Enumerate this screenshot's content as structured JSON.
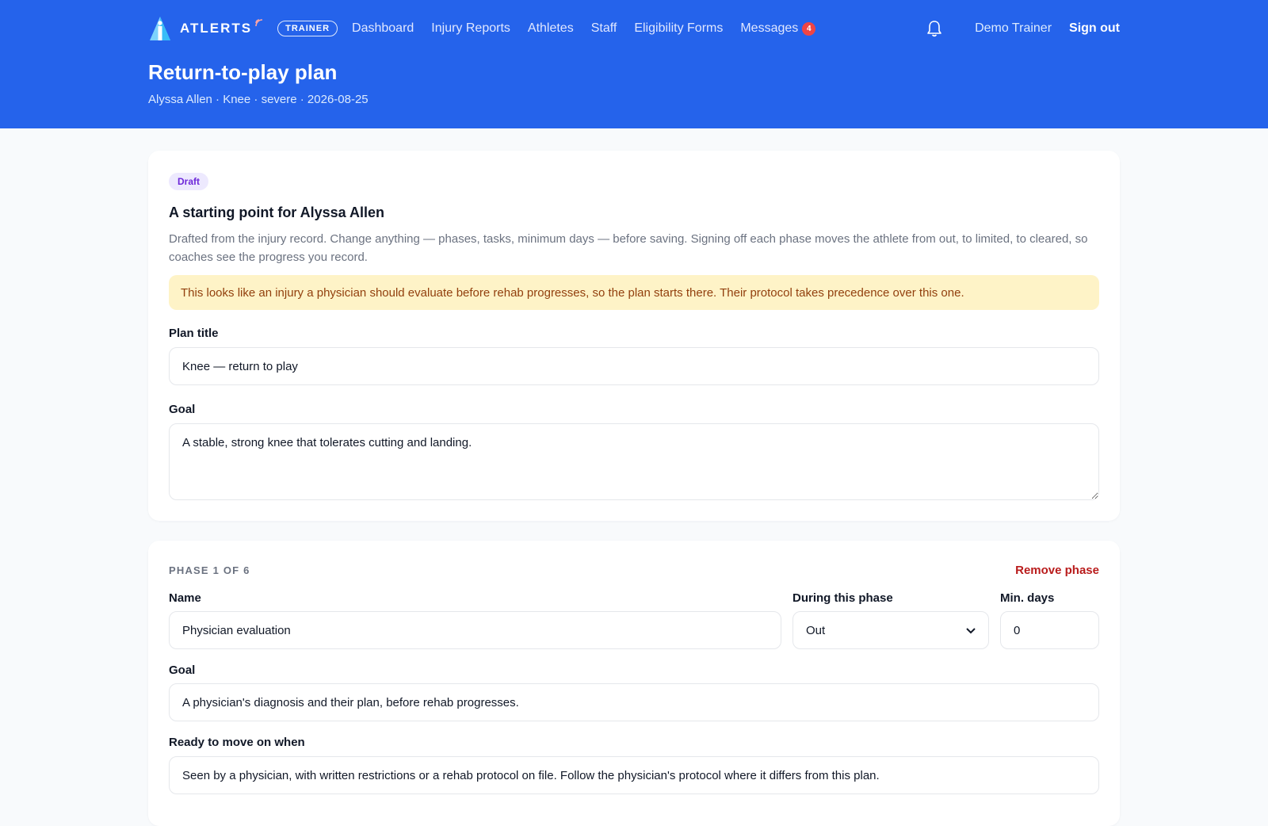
{
  "brand": {
    "name": "ATLERTS",
    "role_badge": "TRAINER"
  },
  "nav": {
    "links": [
      "Dashboard",
      "Injury Reports",
      "Athletes",
      "Staff",
      "Eligibility Forms",
      "Messages"
    ],
    "messages_count": "4",
    "user_name": "Demo Trainer",
    "sign_out": "Sign out"
  },
  "page": {
    "title": "Return-to-play plan",
    "subtitle": "Alyssa Allen · Knee · severe · 2026-08-25"
  },
  "plan": {
    "status_badge": "Draft",
    "heading": "A starting point for Alyssa Allen",
    "description": "Drafted from the injury record. Change anything — phases, tasks, minimum days — before saving. Signing off each phase moves the athlete from out, to limited, to cleared, so coaches see the progress you record.",
    "alert": "This looks like an injury a physician should evaluate before rehab progresses, so the plan starts there. Their protocol takes precedence over this one.",
    "title_label": "Plan title",
    "title_value": "Knee — return to play",
    "goal_label": "Goal",
    "goal_value": "A stable, strong knee that tolerates cutting and landing."
  },
  "phase": {
    "counter": "PHASE 1 OF 6",
    "remove_label": "Remove phase",
    "name_label": "Name",
    "name_value": "Physician evaluation",
    "status_label": "During this phase",
    "status_value": "Out",
    "min_days_label": "Min. days",
    "min_days_value": "0",
    "goal_label": "Goal",
    "goal_value": "A physician's diagnosis and their plan, before rehab progresses.",
    "ready_label": "Ready to move on when",
    "ready_value": "Seen by a physician, with written restrictions or a rehab protocol on file. Follow the physician's protocol where it differs from this plan."
  },
  "colors": {
    "header_bg": "#2563eb",
    "alert_bg": "#fef3c7",
    "danger": "#b91c1c",
    "draft_badge": "#ede9fe"
  },
  "icons": {
    "logo": "athlete-logo-icon",
    "signal": "signal-wave-icon",
    "bell": "bell-icon",
    "select": "chevron-down-icon",
    "resize": "resize-handle-icon"
  }
}
